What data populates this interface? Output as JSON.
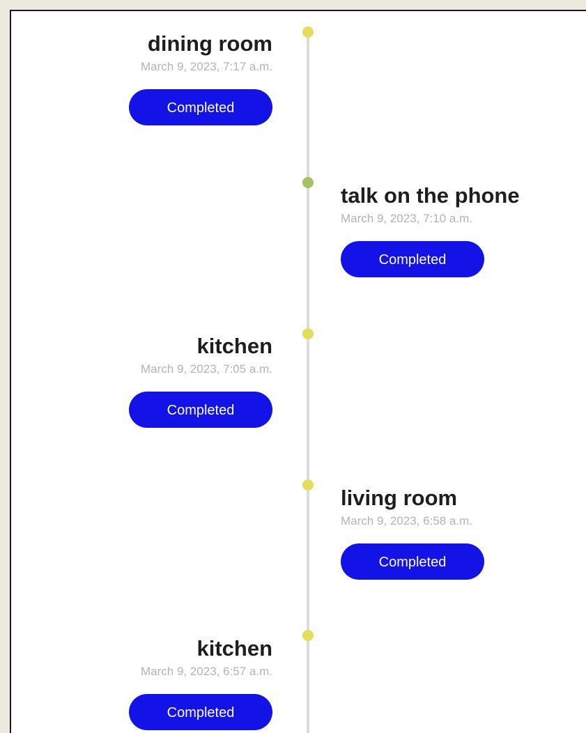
{
  "timeline": {
    "entries": [
      {
        "title": "dining room",
        "timestamp": "March 9, 2023, 7:17 a.m.",
        "status": "Completed",
        "dot_color": "#e4dd5c"
      },
      {
        "title": "talk on the phone",
        "timestamp": "March 9, 2023, 7:10 a.m.",
        "status": "Completed",
        "dot_color": "#a5c25c"
      },
      {
        "title": "kitchen",
        "timestamp": "March 9, 2023, 7:05 a.m.",
        "status": "Completed",
        "dot_color": "#e4dd5c"
      },
      {
        "title": "living room",
        "timestamp": "March 9, 2023, 6:58 a.m.",
        "status": "Completed",
        "dot_color": "#e4dd5c"
      },
      {
        "title": "kitchen",
        "timestamp": "March 9, 2023, 6:57 a.m.",
        "status": "Completed",
        "dot_color": "#e4dd5c"
      }
    ]
  },
  "colors": {
    "page_background": "#ece9df",
    "panel_background": "#ffffff",
    "line": "#dcdcdc",
    "badge_background": "#1313e8",
    "badge_text": "#ffffff",
    "title_text": "#1e1e1e",
    "timestamp_text": "#b3b3b3"
  }
}
